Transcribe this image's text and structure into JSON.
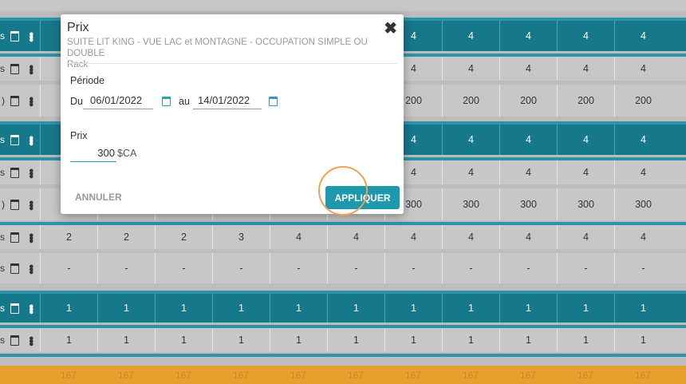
{
  "grid": {
    "row_letters": [
      "s",
      "s",
      ")",
      "s",
      "s",
      ")",
      "s",
      "s",
      "s",
      "s"
    ],
    "r0": [],
    "r1": [
      "4",
      "4",
      "4",
      "4",
      "4"
    ],
    "r2": [
      "4",
      "4",
      "4",
      "4",
      "4"
    ],
    "r3": [
      "200",
      "200",
      "200",
      "200",
      "200"
    ],
    "r4": [
      "4",
      "4",
      "4",
      "4",
      "4"
    ],
    "r5": [
      "4",
      "4",
      "4",
      "4",
      "4"
    ],
    "r6": [
      "300",
      "300",
      "300",
      "300",
      "300"
    ],
    "r7": [
      "2",
      "2",
      "2",
      "3",
      "4",
      "4",
      "4",
      "4",
      "4",
      "4",
      "4"
    ],
    "r8": [
      "-",
      "-",
      "-",
      "-",
      "-",
      "-",
      "-",
      "-",
      "-",
      "-",
      "-"
    ],
    "r9": [
      "1",
      "1",
      "1",
      "1",
      "1",
      "1",
      "1",
      "1",
      "1",
      "1",
      "1"
    ],
    "r10": [
      "1",
      "1",
      "1",
      "1",
      "1",
      "1",
      "1",
      "1",
      "1",
      "1",
      "1"
    ],
    "r11": [
      "167",
      "167",
      "167",
      "167",
      "167",
      "167",
      "167",
      "167",
      "167",
      "167",
      "167"
    ]
  },
  "modal": {
    "title": "Prix",
    "subtitle": "SUITE LIT KING - VUE LAC et MONTAGNE - OCCUPATION SIMPLE OU DOUBLE",
    "rate": "Rack",
    "period_label": "Période",
    "from_label": "Du",
    "from_date": "06/01/2022",
    "to_label": "au",
    "to_date": "14/01/2022",
    "price_label": "Prix",
    "price_value": "300",
    "currency": "$CA",
    "cancel_label": "ANNULER",
    "apply_label": "APPLIQUER"
  },
  "colors": {
    "dark_row": "#16788b",
    "light_row": "#c7c7c7",
    "accent": "#1e98ad",
    "highlight": "#f0a053",
    "footer": "#e89f2b"
  }
}
